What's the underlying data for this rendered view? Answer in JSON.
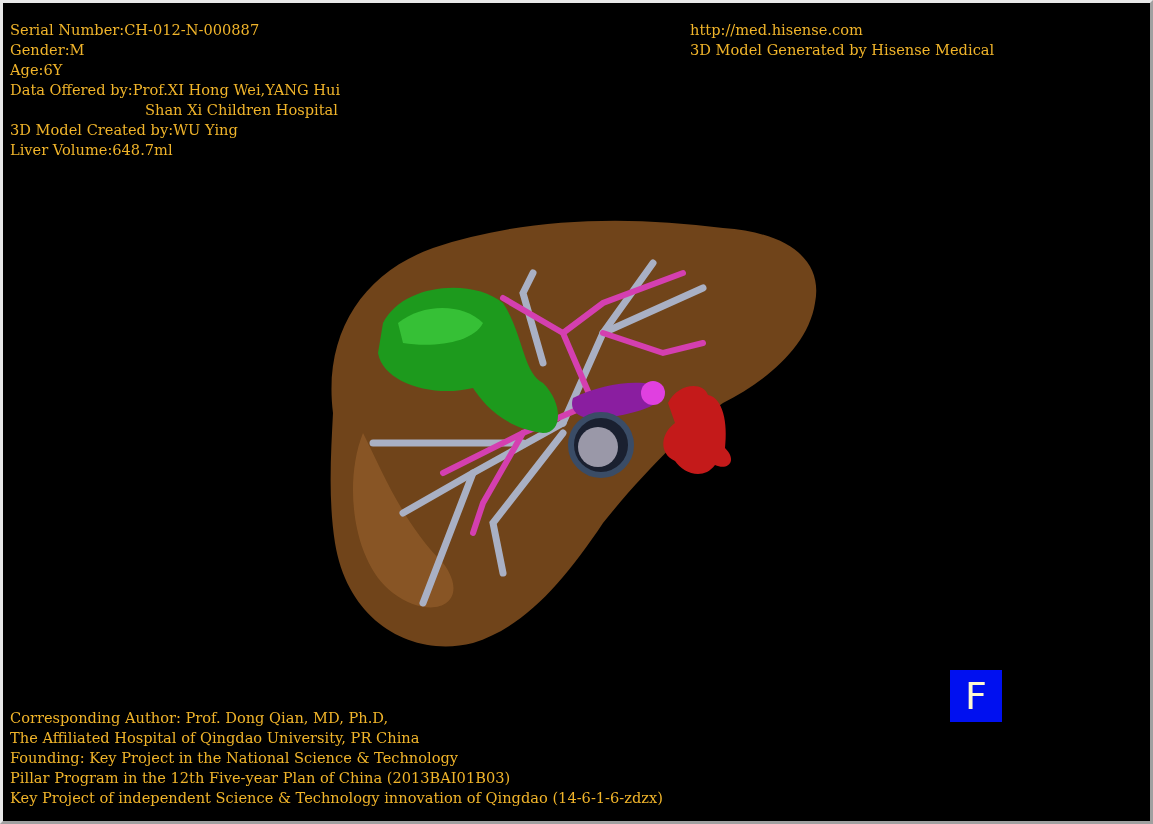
{
  "patient_info": [
    {
      "kind": "field",
      "text": "Serial Number:CH-012-N-000887"
    },
    {
      "kind": "field",
      "text": "Gender:M"
    },
    {
      "kind": "field",
      "text": "Age:6Y"
    },
    {
      "kind": "field",
      "text": "Data Offered by:Prof.XI Hong Wei,YANG Hui"
    },
    {
      "kind": "continuation",
      "text": "Shan Xi Children Hospital"
    },
    {
      "kind": "field",
      "text": "3D Model Created by:WU Ying"
    },
    {
      "kind": "field",
      "text": "Liver Volume:648.7ml"
    }
  ],
  "vendor_info": [
    "http://med.hisense.com",
    "3D Model Generated by Hisense Medical"
  ],
  "credits": [
    "Corresponding Author: Prof. Dong Qian, MD, Ph.D,",
    "The Affiliated Hospital of Qingdao University, PR China",
    "Founding: Key Project in the National Science & Technology",
    "Pillar Program in the 12th Five-year Plan of China (2013BAI01B03)",
    "Key Project of independent Science & Technology innovation of Qingdao (14-6-1-6-zdzx)"
  ],
  "orientation_marker": {
    "label": "F"
  }
}
